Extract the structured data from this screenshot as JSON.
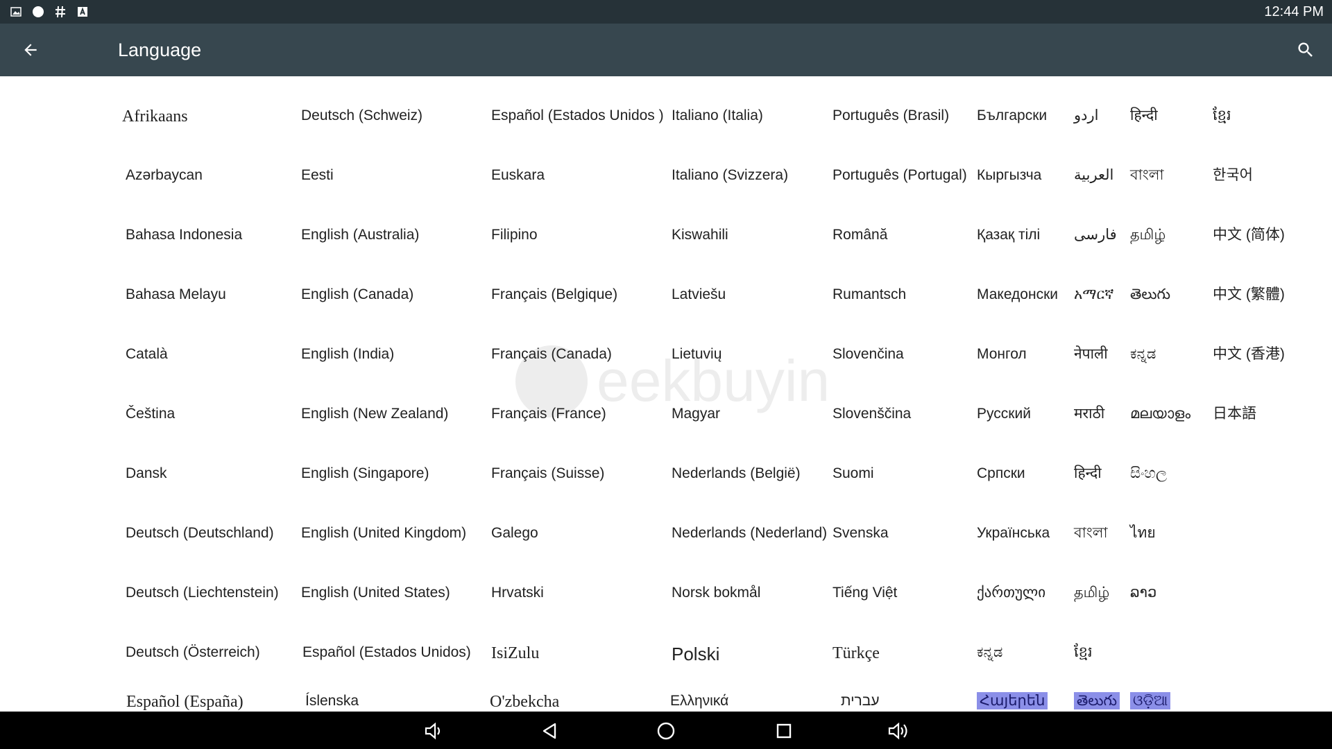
{
  "status_bar": {
    "time": "12:44 PM",
    "icons": [
      "image-icon",
      "circle-icon",
      "hash-icon",
      "a-box-icon"
    ]
  },
  "app_bar": {
    "title": "Language",
    "back_icon": "arrow-left-icon",
    "search_icon": "search-icon"
  },
  "languages": [
    [
      "Afrikaans",
      "Azərbaycan",
      "Bahasa Indonesia",
      "Bahasa Melayu",
      "Català",
      "Čeština",
      "Dansk",
      "Deutsch (Deutschland)",
      "Deutsch (Liechtenstein)",
      "Deutsch (Österreich)",
      "Español (España)"
    ],
    [
      "Deutsch (Schweiz)",
      "Eesti",
      "English (Australia)",
      "English (Canada)",
      "English (India)",
      "English (New Zealand)",
      "English (Singapore)",
      "English (United Kingdom)",
      "English (United States)",
      "Español (Estados Unidos)",
      "Íslenska"
    ],
    [
      "Español (Estados Unidos )",
      "Euskara",
      "Filipino",
      "Français (Belgique)",
      "Français (Canada)",
      "Français (France)",
      "Français (Suisse)",
      "Galego",
      "Hrvatski",
      "IsiZulu",
      "O'zbekcha"
    ],
    [
      "Italiano (Italia)",
      "Italiano (Svizzera)",
      "Kiswahili",
      "Latviešu",
      "Lietuvių",
      "Magyar",
      "Nederlands (België)",
      "Nederlands (Nederland)",
      "Norsk bokmål",
      "Polski",
      "Ελληνικά"
    ],
    [
      "Português (Brasil)",
      "Português (Portugal)",
      "Română",
      "Rumantsch",
      "Slovenčina",
      "Slovenščina",
      "Suomi",
      "Svenska",
      "Tiếng Việt",
      "Türkçe",
      "עברית"
    ],
    [
      "Български",
      "Кыргызча",
      "Қазақ тілі",
      "Македонски",
      "Монгол",
      "Русский",
      "Српски",
      "Українська",
      "ქართული",
      "ಕನ್ನಡ",
      "Հայերեն"
    ],
    [
      "اردو",
      "العربية",
      "فارسی",
      "አማርኛ",
      "नेपाली",
      "मराठी",
      "हिन्दी",
      "বাংলা",
      "தமிழ்",
      "ខ្មែរ",
      "తెలుగు"
    ],
    [
      "हिन्दी",
      "বাংলা",
      "தமிழ்",
      "తెలుగు",
      "ಕನ್ನಡ",
      "മലയാളം",
      "සිංහල",
      "ไทย",
      "ລາວ",
      "",
      "ଓଡ଼ିଆ"
    ],
    [
      "ខ្មែរ",
      "한국어",
      "中文 (简体)",
      "中文 (繁體)",
      "中文 (香港)",
      "日本語"
    ]
  ],
  "nav_bar": {
    "icons": [
      "volume-down-icon",
      "back-triangle-icon",
      "home-circle-icon",
      "recents-square-icon",
      "volume-up-icon"
    ]
  },
  "colors": {
    "status_bar_bg": "#263238",
    "app_bar_bg": "#37474f",
    "highlight": "#8b8fe8",
    "nav_bar_bg": "#000000"
  }
}
